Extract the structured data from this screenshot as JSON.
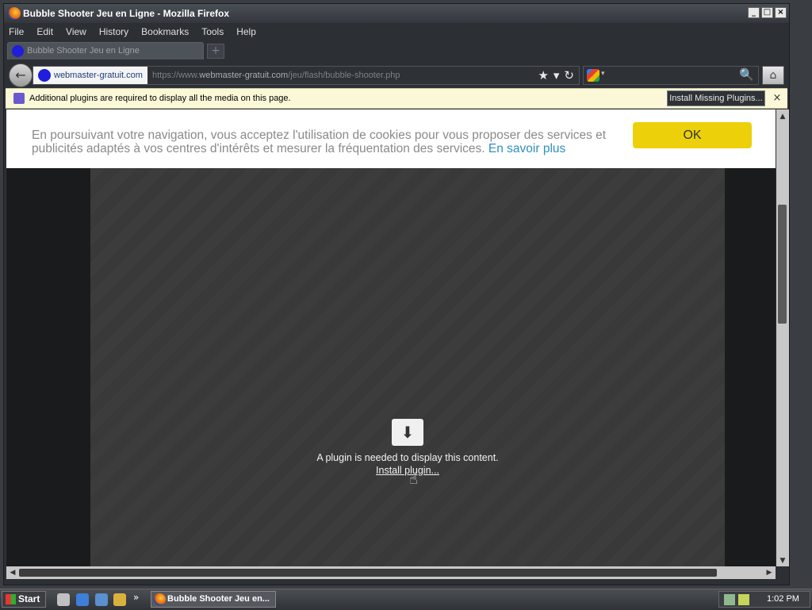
{
  "window": {
    "title": "Bubble Shooter Jeu en Ligne - Mozilla Firefox",
    "controls": {
      "minimize": "_",
      "maximize": "□",
      "close": "×"
    }
  },
  "menu": [
    "File",
    "Edit",
    "View",
    "History",
    "Bookmarks",
    "Tools",
    "Help"
  ],
  "tab": {
    "label": "Bubble Shooter Jeu en Ligne",
    "new_tab": "+"
  },
  "navbar": {
    "back": "←",
    "identity": "webmaster-gratuit.com",
    "url_prefix": "https://www.",
    "url_domain": "webmaster-gratuit.com",
    "url_path": "/jeu/flash/bubble-shooter.php",
    "star": "★",
    "dropdown": "▾",
    "reload": "↻",
    "search_drop": "▾",
    "search_icon": "🔍",
    "home": "⌂"
  },
  "notification": {
    "message": "Additional plugins are required to display all the media on this page.",
    "button": "Install Missing Plugins...",
    "close": "×"
  },
  "cookie": {
    "text": "En poursuivant votre navigation, vous acceptez l'utilisation de cookies pour vous proposer des services et publicités adaptés à vos centres d'intérêts et mesurer la fréquentation des services.",
    "more": "En savoir plus",
    "ok": "OK"
  },
  "plugin": {
    "icon": "⬇",
    "message": "A plugin is needed to display this content.",
    "link": "Install plugin..."
  },
  "scroll": {
    "up": "▲",
    "down": "▼",
    "left": "◀",
    "right": "▶"
  },
  "taskbar": {
    "start": "Start",
    "more": "»",
    "task": "Bubble Shooter Jeu en...",
    "clock": "1:02 PM"
  }
}
